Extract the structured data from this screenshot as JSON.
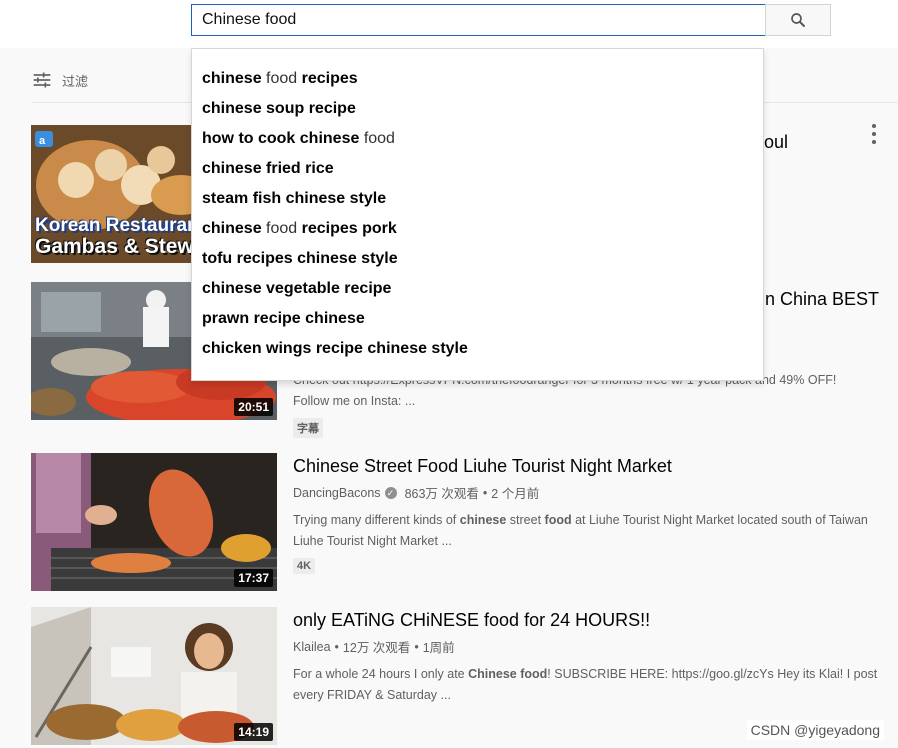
{
  "search": {
    "value": "Chinese food"
  },
  "filter": {
    "label": "过滤"
  },
  "suggestions": [
    {
      "prefix": "chinese ",
      "match": "food",
      "suffix": " recipes"
    },
    {
      "prefix": "chinese soup recipe",
      "match": "",
      "suffix": ""
    },
    {
      "prefix": "how to cook chinese ",
      "match": "food",
      "suffix": ""
    },
    {
      "prefix": "chinese fried rice",
      "match": "",
      "suffix": ""
    },
    {
      "prefix": "steam fish chinese style",
      "match": "",
      "suffix": ""
    },
    {
      "prefix": "chinese ",
      "match": "food",
      "suffix": " recipes pork"
    },
    {
      "prefix": "tofu recipes chinese style",
      "match": "",
      "suffix": ""
    },
    {
      "prefix": "chinese vegetable recipe",
      "match": "",
      "suffix": ""
    },
    {
      "prefix": "prawn recipe chinese",
      "match": "",
      "suffix": ""
    },
    {
      "prefix": "chicken wings recipe chinese style",
      "match": "",
      "suffix": ""
    }
  ],
  "videos": [
    {
      "title_tail": "oul",
      "thumb_text_1": "Korean Restaurant",
      "thumb_text_2": "Gambas & Stew"
    },
    {
      "title_tail": "n China BEST",
      "duration": "20:51",
      "desc_line1": "Check out https://ExpressVPN.com/thefoodranger for 3 months free w/ 1 year pack and 49% OFF!",
      "desc_line2": "Follow me on Insta: ...",
      "badge": "字幕"
    },
    {
      "title": "Chinese Street Food Liuhe Tourist Night Market",
      "channel": "DancingBacons",
      "views": "863万 次观看",
      "sep": "•",
      "age": "2 个月前",
      "desc_a": "Trying many different kinds of ",
      "desc_b": "chinese",
      "desc_c": " street ",
      "desc_d": "food",
      "desc_e": " at Liuhe Tourist Night Market located south of Taiwan",
      "desc_line2": "Liuhe Tourist Night Market ...",
      "duration": "17:37",
      "badge": "4K"
    },
    {
      "title": "only EATiNG CHiNESE food for 24 HOURS!!",
      "channel": "Klailea",
      "views": "12万 次观看",
      "sep": "•",
      "age": "1周前",
      "desc_a": "For a whole 24 hours I only ate ",
      "desc_b": "Chinese food",
      "desc_c": "! SUBSCRIBE HERE: https://goo.gl/zcYs Hey its Klai! I post",
      "desc_line2": "every FRIDAY & Saturday ...",
      "duration": "14:19"
    }
  ],
  "watermark": "CSDN @yigeyadong",
  "colors": {
    "accent": "#1c62b9",
    "text": "#030303",
    "meta": "#606060"
  },
  "icons": {
    "search": "search-icon",
    "filter": "filter-icon",
    "more": "more-vert-icon"
  }
}
